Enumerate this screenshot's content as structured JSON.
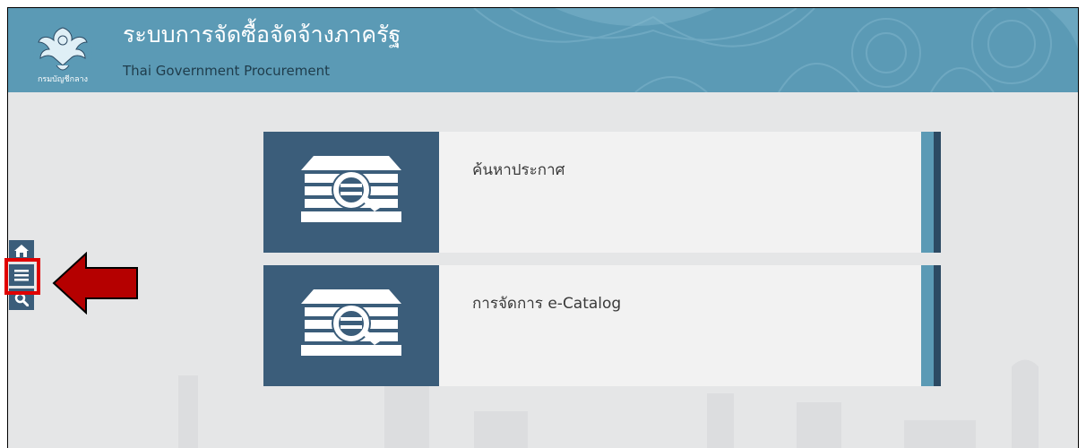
{
  "header": {
    "title": "ระบบการจัดซื้อจัดจ้างภาครัฐ",
    "subtitle": "Thai Government Procurement",
    "logo_text": "กรมบัญชีกลาง"
  },
  "tiles": [
    {
      "label": "ค้นหาประกาศ",
      "icon": "search-announcement-icon"
    },
    {
      "label": "การจัดการ e-Catalog",
      "icon": "catalog-search-icon"
    }
  ],
  "sidebar": {
    "items": [
      {
        "name": "home",
        "icon": "home-icon"
      },
      {
        "name": "menu",
        "icon": "hamburger-menu-icon"
      },
      {
        "name": "search",
        "icon": "search-icon"
      }
    ]
  },
  "annotation": {
    "highlight_color": "#e00000",
    "arrow_color": "#b50000"
  },
  "colors": {
    "header_bg": "#5b9ab5",
    "tile_dark": "#3b5d7a",
    "tile_light": "#f2f2f2",
    "page_bg": "#e5e6e7"
  }
}
